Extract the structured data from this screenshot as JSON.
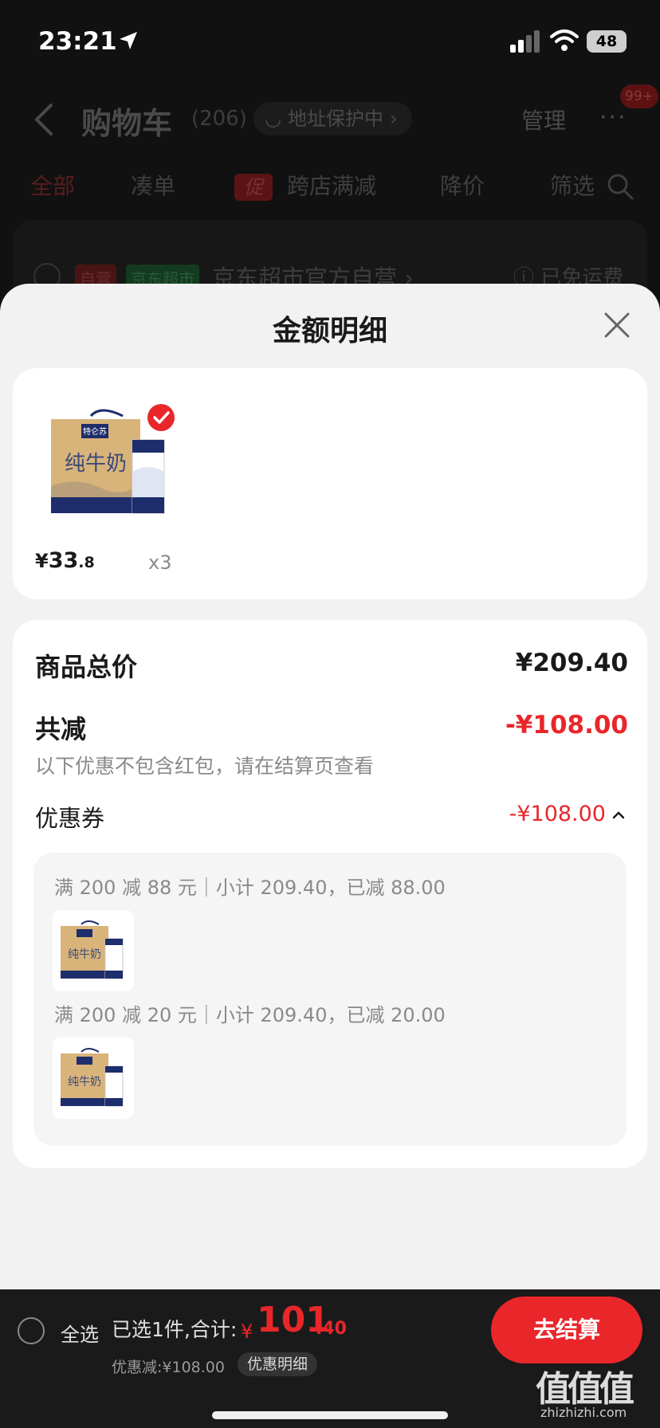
{
  "status_bar": {
    "time": "23:21",
    "battery": "48"
  },
  "nav": {
    "title": "购物车",
    "count": "(206)",
    "address_protect": "地址保护中",
    "manage": "管理",
    "more": "···",
    "badge": "99+"
  },
  "tabs": {
    "all": "全部",
    "cou_dan": "凑单",
    "promo_tag": "促",
    "cross_store": "跨店满减",
    "price_drop": "降价",
    "filter": "筛选"
  },
  "shop": {
    "self_tag": "自营",
    "market_tag": "京东超市",
    "name": "京东超市官方自营 ›",
    "freight": "ⓘ 已免运费"
  },
  "sheet": {
    "title": "金额明细",
    "product": {
      "box_brand": "特仑苏",
      "box_text": "纯牛奶",
      "price_yen": "¥",
      "price_int": "33",
      "price_dec": ".8",
      "qty": "x3"
    },
    "total_label": "商品总价",
    "total_value": "¥209.40",
    "reduce_label": "共减",
    "reduce_value": "-¥108.00",
    "reduce_note": "以下优惠不包含红包，请在结算页查看",
    "coupon_label": "优惠券",
    "coupon_value": "-¥108.00",
    "coupons": [
      {
        "desc": "满 200 减 88 元｜小计 209.40，已减 88.00"
      },
      {
        "desc": "满 200 减 20 元｜小计 209.40，已减 20.00"
      }
    ]
  },
  "bottom_bar": {
    "select_all": "全选",
    "selected_summary": "已选1件,合计:",
    "total_yen": "¥",
    "total_int": "101",
    "total_dec": ".40",
    "discount_summary": "优惠减:¥108.00",
    "discount_detail": "优惠明细",
    "checkout": "去结算"
  },
  "watermark": {
    "main": "值值值",
    "sub": "zhizhizhi.com"
  },
  "colors": {
    "accent": "#e9262a",
    "sheet_bg": "#f2f2f2",
    "card_bg": "#ffffff",
    "bar_bg": "#1a1a1a"
  }
}
